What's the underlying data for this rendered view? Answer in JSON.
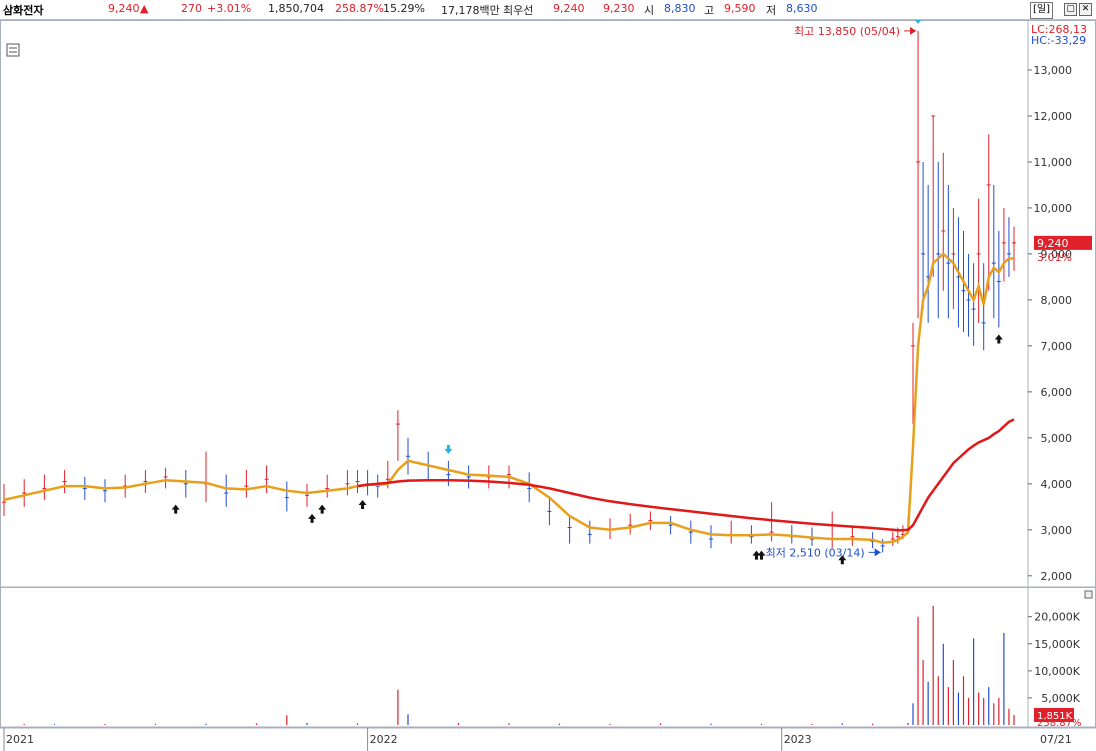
{
  "header": {
    "name": "삼화전자",
    "price": "9,240",
    "change_arrow": "▲",
    "change": "270",
    "change_rate": "+3.01%",
    "volume": "1,850,704",
    "volume_rate": "258.87%",
    "turnover": "15.29%",
    "amount": "17,178백만",
    "best_label": "최우선",
    "best_ask": "9,240",
    "best_bid": "9,230",
    "open_label": "시",
    "open": "8,830",
    "high_label": "고",
    "high": "9,590",
    "low_label": "저",
    "low": "8,630",
    "period_button": "[일]",
    "restore_icon": "window-restore-icon",
    "close_icon": "window-close-icon"
  },
  "colors": {
    "up": "#e0202a",
    "down": "#1f4fd1",
    "ma_short": "#e8a01c",
    "ma_long": "#e01818",
    "grid": "#d8dde6",
    "signal_buy": "#111111",
    "signal_cyan": "#22b5e8"
  },
  "chart_data": [
    {
      "type": "line",
      "title": "",
      "y_axis_side": "right",
      "ylim": [
        1800,
        14000
      ],
      "yticks": [
        2000,
        3000,
        4000,
        5000,
        6000,
        7000,
        8000,
        9000,
        10000,
        11000,
        12000,
        13000
      ],
      "ytick_labels": [
        "2,000",
        "3,000",
        "4,000",
        "5,000",
        "6,000",
        "7,000",
        "8,000",
        "9,000",
        "10,000",
        "11,000",
        "12,000",
        "13,000"
      ],
      "x_labels": [
        "2021",
        "2022",
        "2023",
        "07/21"
      ],
      "corner_labels": {
        "lc": "LC:268,13",
        "hc": "HC:-33,29"
      },
      "current_price_label": "9,240",
      "current_rate_label": "3.01%",
      "max_annotation": {
        "text": "최고 13,850 (05/04)",
        "value": 13850
      },
      "min_annotation": {
        "text": "최저 2,510 (03/14)",
        "value": 2510
      },
      "price_series": {
        "x": [
          0.0,
          0.02,
          0.04,
          0.06,
          0.08,
          0.1,
          0.12,
          0.14,
          0.16,
          0.18,
          0.2,
          0.22,
          0.24,
          0.26,
          0.28,
          0.3,
          0.32,
          0.34,
          0.35,
          0.36,
          0.37,
          0.38,
          0.39,
          0.4,
          0.42,
          0.44,
          0.46,
          0.48,
          0.5,
          0.52,
          0.54,
          0.56,
          0.58,
          0.6,
          0.62,
          0.64,
          0.66,
          0.68,
          0.7,
          0.72,
          0.74,
          0.76,
          0.78,
          0.8,
          0.82,
          0.84,
          0.86,
          0.87,
          0.88,
          0.885,
          0.89,
          0.895,
          0.9,
          0.905,
          0.91,
          0.915,
          0.92,
          0.925,
          0.93,
          0.935,
          0.94,
          0.945,
          0.95,
          0.955,
          0.96,
          0.965,
          0.97,
          0.975,
          0.98,
          0.985,
          0.99,
          0.995,
          1.0
        ],
        "close": [
          3600,
          3800,
          3900,
          4050,
          3900,
          3850,
          3950,
          4050,
          4150,
          4000,
          4000,
          3800,
          3950,
          4100,
          3700,
          3750,
          3900,
          4000,
          4050,
          4000,
          3950,
          4100,
          5300,
          4600,
          4400,
          4200,
          4150,
          4150,
          4200,
          3900,
          3400,
          3050,
          2900,
          3000,
          3100,
          3200,
          3100,
          2950,
          2800,
          2900,
          2850,
          2950,
          2850,
          2800,
          2800,
          2850,
          2750,
          2650,
          2800,
          2850,
          2900,
          3000,
          7000,
          11000,
          9000,
          8500,
          12000,
          9000,
          9500,
          8800,
          9000,
          8500,
          8200,
          8000,
          7800,
          9000,
          7500,
          10500,
          8800,
          8400,
          9240,
          9000,
          9240
        ],
        "high": [
          4000,
          4100,
          4200,
          4300,
          4150,
          4100,
          4200,
          4300,
          4350,
          4300,
          4700,
          4200,
          4300,
          4400,
          4050,
          4000,
          4200,
          4300,
          4300,
          4300,
          4200,
          4500,
          5600,
          5000,
          4700,
          4500,
          4400,
          4400,
          4400,
          4250,
          3700,
          3300,
          3200,
          3250,
          3350,
          3400,
          3300,
          3200,
          3100,
          3200,
          3100,
          3600,
          3100,
          3050,
          3400,
          3050,
          2950,
          2800,
          2950,
          3050,
          3100,
          3300,
          7500,
          13850,
          11000,
          10500,
          12000,
          11000,
          11200,
          10500,
          10000,
          9800,
          9500,
          9000,
          8800,
          10200,
          8800,
          11600,
          10500,
          9500,
          10000,
          9800,
          9590
        ],
        "low": [
          3300,
          3500,
          3650,
          3800,
          3650,
          3600,
          3700,
          3800,
          3900,
          3700,
          3600,
          3500,
          3700,
          3800,
          3400,
          3500,
          3700,
          3750,
          3800,
          3750,
          3700,
          3900,
          4500,
          4200,
          4100,
          3950,
          3900,
          3900,
          3900,
          3600,
          3100,
          2700,
          2700,
          2800,
          2900,
          3000,
          2900,
          2700,
          2600,
          2700,
          2700,
          2750,
          2700,
          2650,
          2600,
          2650,
          2600,
          2510,
          2650,
          2700,
          2800,
          2900,
          5300,
          7600,
          7800,
          7500,
          8500,
          7600,
          8200,
          7600,
          7800,
          7400,
          7300,
          7200,
          7000,
          7500,
          6900,
          8200,
          7600,
          7400,
          8400,
          8500,
          8630
        ]
      },
      "series": [
        {
          "values": [
            3650,
            3750,
            3850,
            3950,
            3950,
            3900,
            3920,
            4000,
            4080,
            4050,
            4020,
            3900,
            3880,
            3950,
            3850,
            3800,
            3850,
            3900,
            3950,
            3980,
            3980,
            4000,
            4300,
            4500,
            4400,
            4300,
            4200,
            4180,
            4150,
            4000,
            3700,
            3300,
            3050,
            3000,
            3050,
            3150,
            3150,
            3000,
            2900,
            2880,
            2880,
            2900,
            2870,
            2830,
            2800,
            2800,
            2780,
            2720,
            2740,
            2780,
            2850,
            2950,
            4800,
            7000,
            8000,
            8300,
            8800,
            8900,
            9000,
            8900,
            8800,
            8600,
            8400,
            8200,
            8000,
            8300,
            7900,
            8500,
            8700,
            8600,
            8800,
            8900,
            8900
          ]
        },
        {
          "values": [
            null,
            null,
            null,
            null,
            null,
            null,
            null,
            null,
            null,
            null,
            null,
            null,
            null,
            null,
            null,
            null,
            null,
            null,
            3950,
            3980,
            4000,
            4020,
            4050,
            4070,
            4080,
            4080,
            4070,
            4050,
            4020,
            3980,
            3900,
            3800,
            3700,
            3620,
            3560,
            3500,
            3450,
            3400,
            3350,
            3300,
            3250,
            3210,
            3170,
            3130,
            3100,
            3070,
            3040,
            3020,
            3000,
            2990,
            2990,
            3000,
            3100,
            3300,
            3500,
            3700,
            3850,
            4000,
            4150,
            4300,
            4450,
            4550,
            4650,
            4750,
            4830,
            4900,
            4950,
            5000,
            5080,
            5150,
            5250,
            5350,
            5400
          ]
        }
      ],
      "signals": [
        {
          "x": 0.17,
          "kind": "buy"
        },
        {
          "x": 0.305,
          "kind": "buy"
        },
        {
          "x": 0.315,
          "kind": "buy"
        },
        {
          "x": 0.355,
          "kind": "buy"
        },
        {
          "x": 0.44,
          "kind": "sell"
        },
        {
          "x": 0.745,
          "kind": "buy"
        },
        {
          "x": 0.75,
          "kind": "buy"
        },
        {
          "x": 0.83,
          "kind": "buy"
        },
        {
          "x": 0.905,
          "kind": "sell"
        },
        {
          "x": 0.985,
          "kind": "buy"
        }
      ]
    },
    {
      "type": "bar",
      "title": "volume",
      "y_axis_side": "right",
      "ylim": [
        0,
        24000
      ],
      "yticks": [
        5000,
        10000,
        15000,
        20000
      ],
      "ytick_labels": [
        "5,000K",
        "10,000K",
        "15,000K",
        "20,000K"
      ],
      "current_volume_label": "1,851K",
      "current_rate_label": "258.87%",
      "x": [
        0.02,
        0.05,
        0.1,
        0.15,
        0.2,
        0.25,
        0.28,
        0.3,
        0.35,
        0.39,
        0.4,
        0.45,
        0.5,
        0.55,
        0.6,
        0.65,
        0.7,
        0.75,
        0.8,
        0.83,
        0.86,
        0.895,
        0.9,
        0.905,
        0.91,
        0.915,
        0.92,
        0.925,
        0.93,
        0.935,
        0.94,
        0.945,
        0.95,
        0.955,
        0.96,
        0.965,
        0.97,
        0.975,
        0.98,
        0.985,
        0.99,
        0.995,
        1.0
      ],
      "values": [
        200,
        150,
        180,
        220,
        250,
        300,
        1800,
        400,
        300,
        6500,
        2000,
        350,
        300,
        250,
        200,
        300,
        250,
        200,
        200,
        300,
        250,
        400,
        4000,
        20000,
        12000,
        8000,
        22000,
        9000,
        15000,
        7000,
        12000,
        6000,
        9000,
        5000,
        16000,
        6000,
        5000,
        7000,
        4000,
        5000,
        17000,
        3000,
        1851
      ]
    }
  ]
}
